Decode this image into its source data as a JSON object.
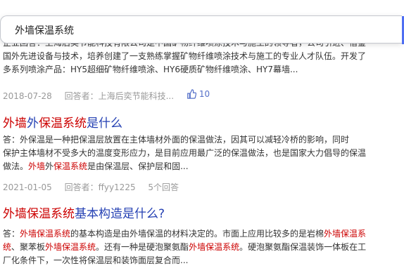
{
  "search": {
    "query": "外墙保温系统"
  },
  "results": [
    {
      "snippet_lines": [
        [
          {
            "t": "企业回答：上海后奕节能科技有限公司是中国矿物纤维喷涂技术与施工的领导者，公司引进、借鉴"
          }
        ],
        [
          {
            "t": "国外先进设备与技术，培养创建了一支熟练掌握矿物纤维喷涂技术与施工的专业人才队伍。开发了"
          }
        ],
        [
          {
            "t": "多系列喷涂产品：HY5超细矿物纤维喷涂、HY6硬质矿物纤维喷涂、HY7幕墙..."
          }
        ]
      ],
      "meta": {
        "date": "2018-07-28",
        "answerer": "回答者：上海后奕节能科技...",
        "likes": "10"
      }
    },
    {
      "title": [
        {
          "t": "外墙",
          "hl": true
        },
        {
          "t": "外",
          "hl": false
        },
        {
          "t": "保温系统",
          "hl": true
        },
        {
          "t": "是什么",
          "hl": false
        }
      ],
      "snippet_lines": [
        [
          {
            "t": "答：外保温是一种把保温层放置在主体墙材外面的保温做法，因其可以减轻冷桥的影响，同时"
          }
        ],
        [
          {
            "t": "保护主体墙材不受多大的温度变形应力，是目前应用最广泛的保温做法，也是国家大力倡导的保温"
          }
        ],
        [
          {
            "t": "做法。"
          },
          {
            "t": "外墙",
            "hl": true
          },
          {
            "t": "外"
          },
          {
            "t": "保温系统",
            "hl": true
          },
          {
            "t": "是由保温层、保护层和固..."
          }
        ]
      ],
      "meta": {
        "date": "2021-01-05",
        "answerer": "回答者：ffyy1225",
        "answers": "5个回答"
      }
    },
    {
      "title": [
        {
          "t": "外墙保温系统",
          "hl": true
        },
        {
          "t": "基本构造是什么?",
          "hl": false
        }
      ],
      "snippet_lines": [
        [
          {
            "t": "答："
          },
          {
            "t": "外墙保温系统",
            "hl": true
          },
          {
            "t": "的基本构造是由外墙保温的材料决定的。市面上应用比较多的是岩棉"
          },
          {
            "t": "外墙保温系",
            "hl": true
          }
        ],
        [
          {
            "t": "统",
            "hl": true
          },
          {
            "t": "、聚苯板"
          },
          {
            "t": "外墙保温系统",
            "hl": true
          },
          {
            "t": "。还有一种是硬泡聚氨酯"
          },
          {
            "t": "外墙保温系统",
            "hl": true
          },
          {
            "t": "。硬泡聚氨酯保温装饰一体板在工"
          }
        ],
        [
          {
            "t": "厂化条件下，一次性将保温层和装饰面层复合而..."
          }
        ]
      ]
    }
  ],
  "colors": {
    "title_link": "#2440b3",
    "highlight": "#cc0000",
    "meta": "#999999",
    "accent": "#4e6ef2"
  },
  "icons": {
    "like": "thumbs-up-icon"
  }
}
